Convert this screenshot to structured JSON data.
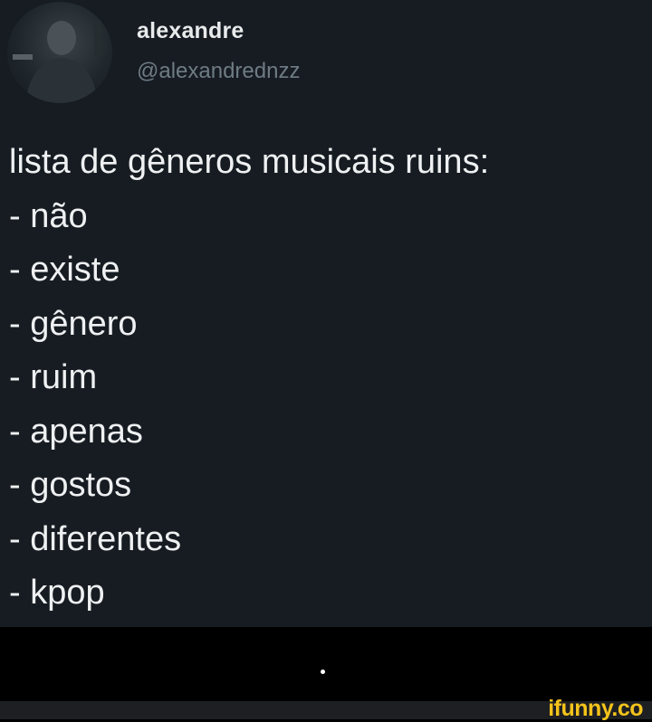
{
  "tweet": {
    "display_name": "alexandre",
    "handle": "@alexandrednzz",
    "lines": [
      "lista de gêneros musicais ruins:",
      "- não",
      "- existe",
      "- gênero",
      "- ruim",
      "- apenas",
      "- gostos",
      "- diferentes",
      "- kpop"
    ]
  },
  "caption": ".",
  "watermark": "ifunny.co",
  "colors": {
    "tweet_background": "#161c22",
    "text": "#eef0f1",
    "handle": "#6f7b84",
    "watermark": "#f4c31b"
  }
}
